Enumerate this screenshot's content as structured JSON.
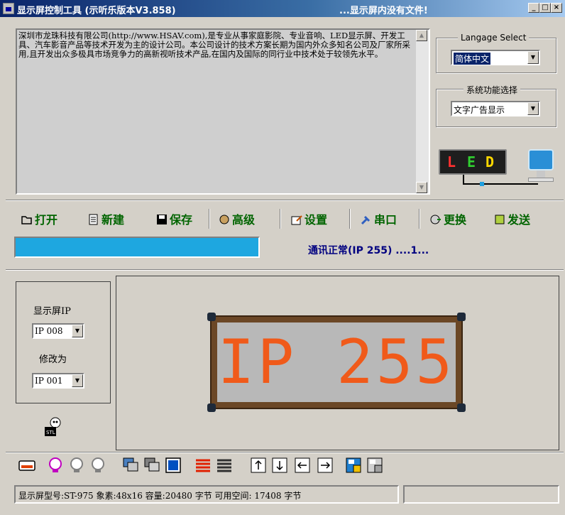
{
  "window": {
    "title": "显示屏控制工具 (示听乐版本V3.858)",
    "status_title": "...显示屏内没有文件!",
    "controls": [
      "_",
      "□",
      "×"
    ]
  },
  "description": {
    "text": "深圳市龙珠科技有限公司(http://www.HSAV.com),是专业从事家庭影院、专业音响、LED显示屏、开发工具、汽车影音产品等技术开发为主的设计公司。本公司设计的技术方案长期为国内外众多知名公司及厂家所采用,且开发出众多极具市场竞争力的高新视听技术产品,在国内及国际的同行业中技术处于较领先水平。"
  },
  "language_group": {
    "title": "Langage Select",
    "selected": "简体中文"
  },
  "function_group": {
    "title": "系统功能选择",
    "selected": "文字广告显示"
  },
  "led_logo": {
    "letters": [
      "L",
      "E",
      "D"
    ],
    "colors": [
      "#ff3030",
      "#30d030",
      "#ffd800"
    ]
  },
  "toolbar": {
    "open": "打开",
    "new": "新建",
    "save": "保存",
    "advanced": "高级",
    "settings": "设置",
    "serial": "串口",
    "change": "更换",
    "send": "发送"
  },
  "progress": {
    "value": 1.0,
    "color": "#1ea7e0"
  },
  "comm_status": "通讯正常(IP 255) ....1...",
  "ip_panel": {
    "display_ip_label": "显示屏IP",
    "display_ip_value": "IP 008",
    "change_to_label": "修改为",
    "change_to_value": "IP 001"
  },
  "led_screen": {
    "text": "IP 255",
    "text_color": "#f05a1a",
    "screen_color": "#b8b8b8",
    "frame_color": "#6b4726"
  },
  "status_bar": {
    "text": "显示屏型号:ST-975  象素:48x16  容量:20480 字节 可用空间: 17408 字节"
  }
}
